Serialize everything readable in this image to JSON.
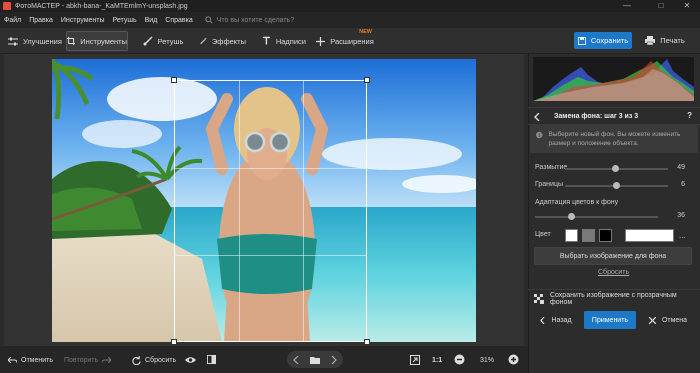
{
  "window": {
    "title": "ФотоМАСТЕР - abkh-bana-_KaMTEmlmY-unsplash.jpg",
    "minimize": "—",
    "maximize": "□",
    "close": "✕"
  },
  "menu": {
    "items": [
      "Файл",
      "Правка",
      "Инструменты",
      "Ретушь",
      "Вид",
      "Справка"
    ],
    "search_placeholder": "Что вы хотите сделать?"
  },
  "tabs": [
    {
      "label": "Улучшения",
      "icon": "sliders-icon"
    },
    {
      "label": "Инструменты",
      "icon": "crop-icon",
      "active": true
    },
    {
      "label": "Ретушь",
      "icon": "brush-icon"
    },
    {
      "label": "Эффекты",
      "icon": "magic-wand-icon"
    },
    {
      "label": "Надписи",
      "icon": "text-icon"
    },
    {
      "label": "Расширения",
      "icon": "plus-icon",
      "badge": "NEW"
    }
  ],
  "actions": {
    "save": "Сохранить",
    "print": "Печать"
  },
  "bottom": {
    "undo": "Отменить",
    "redo": "Повторить",
    "reset": "Сбросить",
    "ratio": "1:1",
    "zoom": "31%"
  },
  "panel": {
    "step_title": "Замена фона: шаг 3 из 3",
    "help": "?",
    "info": "Выберите новый фон. Вы можете изменить размер и положение объекта.",
    "blur_label": "Размытие",
    "blur_value": "49",
    "blur_fraction": 0.49,
    "borders_label": "Границы",
    "borders_value": "6",
    "borders_fraction": 0.5,
    "adapt_label": "Адаптация цветов к фону",
    "adapt_value": "36",
    "adapt_fraction": 0.3,
    "color_label": "Цвет",
    "more": "...",
    "choose_image": "Выбрать изображение для фона",
    "reset_link": "Сбросить",
    "save_transparent": "Сохранить изображение с прозрачным фоном",
    "back": "Назад",
    "apply": "Применить",
    "cancel": "Отмена"
  },
  "colors": {
    "accent": "#1e78c8",
    "new_badge": "#e67e22",
    "swatches": [
      "#ffffff",
      "#7a7a7a",
      "#000000",
      "#ffffff"
    ]
  }
}
